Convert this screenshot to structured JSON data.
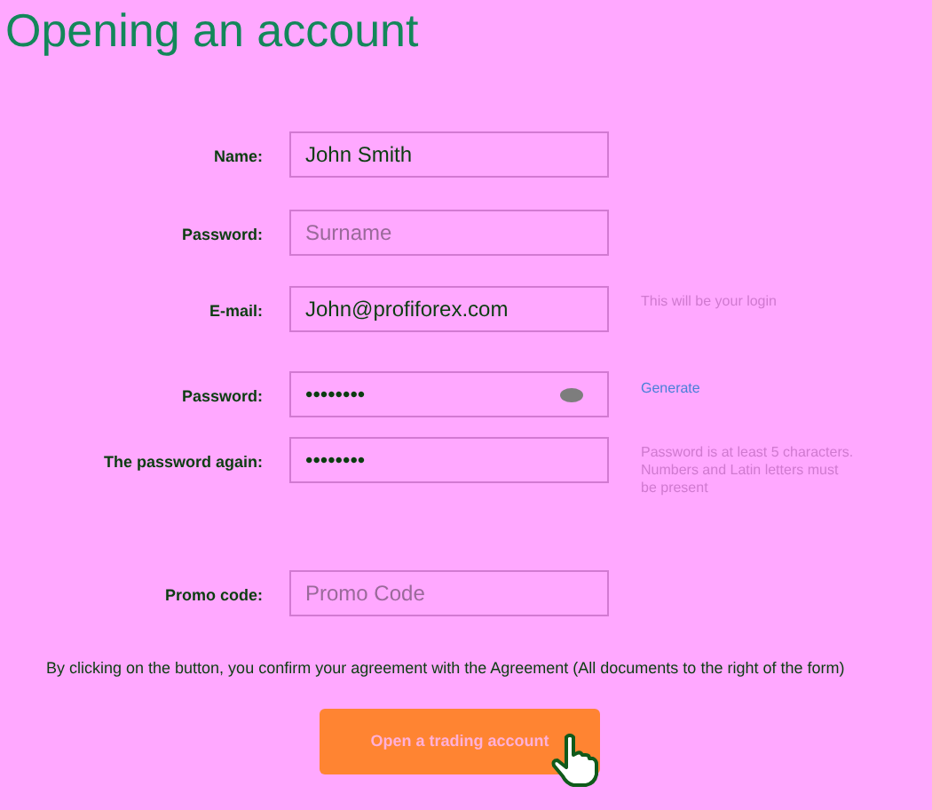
{
  "title": "Opening an account",
  "fields": [
    {
      "label": "Name:",
      "value": "John Smith"
    },
    {
      "label": "Password:",
      "placeholder": "Surname"
    },
    {
      "label": "E-mail:",
      "value": "John@profiforex.com",
      "note": "This will be your login"
    },
    {
      "label": "Password:",
      "value": "••••••••",
      "kind": "password",
      "link": "Generate"
    },
    {
      "label": "The password again:",
      "value": "••••••••",
      "note": "Password is at least 5 characters. Numbers and Latin letters must be present"
    },
    {
      "label": "Promo code:",
      "placeholder": "Promo Code"
    }
  ],
  "agreement": "By clicking on the button, you confirm your agreement with the Agreement (All documents to the right of the form)",
  "button": "Open a trading account"
}
